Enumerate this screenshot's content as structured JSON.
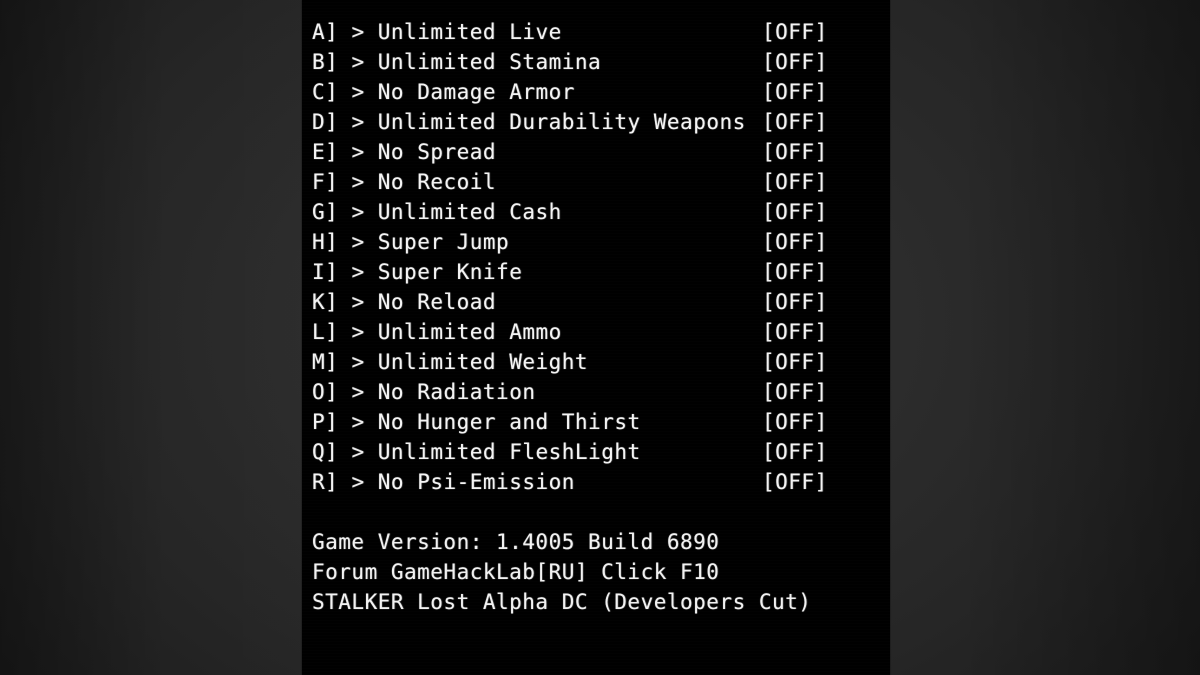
{
  "panel": {
    "background_color": "#000000",
    "text_color": "#f2f2f2",
    "backdrop_color": "#2c2c2c"
  },
  "cheats": [
    {
      "key": "A]",
      "arrow": ">",
      "label": "Unlimited Live",
      "state": "[OFF]"
    },
    {
      "key": "B]",
      "arrow": ">",
      "label": "Unlimited Stamina",
      "state": "[OFF]"
    },
    {
      "key": "C]",
      "arrow": ">",
      "label": "No Damage Armor",
      "state": "[OFF]"
    },
    {
      "key": "D]",
      "arrow": ">",
      "label": "Unlimited Durability Weapons",
      "state": "[OFF]"
    },
    {
      "key": "E]",
      "arrow": ">",
      "label": "No Spread",
      "state": "[OFF]"
    },
    {
      "key": "F]",
      "arrow": ">",
      "label": "No Recoil",
      "state": "[OFF]"
    },
    {
      "key": "G]",
      "arrow": ">",
      "label": "Unlimited Cash",
      "state": "[OFF]"
    },
    {
      "key": "H]",
      "arrow": ">",
      "label": "Super Jump",
      "state": "[OFF]"
    },
    {
      "key": "I]",
      "arrow": ">",
      "label": "Super Knife",
      "state": "[OFF]"
    },
    {
      "key": "K]",
      "arrow": ">",
      "label": "No Reload",
      "state": "[OFF]"
    },
    {
      "key": "L]",
      "arrow": ">",
      "label": "Unlimited Ammo",
      "state": "[OFF]"
    },
    {
      "key": "M]",
      "arrow": ">",
      "label": "Unlimited Weight",
      "state": "[OFF]"
    },
    {
      "key": "O]",
      "arrow": ">",
      "label": "No Radiation",
      "state": "[OFF]"
    },
    {
      "key": "P]",
      "arrow": ">",
      "label": "No Hunger and Thirst",
      "state": "[OFF]"
    },
    {
      "key": "Q]",
      "arrow": ">",
      "label": "Unlimited FleshLight",
      "state": "[OFF]"
    },
    {
      "key": "R]",
      "arrow": ">",
      "label": "No Psi-Emission",
      "state": "[OFF]"
    }
  ],
  "footer": {
    "game_version": "Game Version: 1.4005 Build 6890",
    "forum": "Forum GameHackLab[RU] Click F10",
    "game_title": "STALKER Lost Alpha DC (Developers Cut)"
  }
}
